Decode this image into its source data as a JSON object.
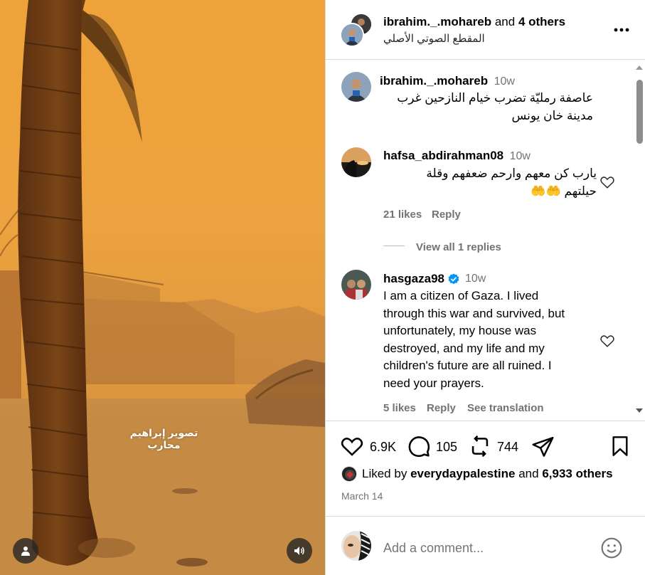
{
  "media": {
    "watermark_text": "تصوير إبراهيم محارب"
  },
  "header": {
    "author": "ibrahim._.mohareb",
    "and_text": "and",
    "others": "4 others",
    "audio_label": "المقطع الصوتي الأصلي"
  },
  "caption": {
    "username": "ibrahim._.mohareb",
    "time": "10w",
    "text_line1": "عاصفة رمليّة تضرب خيام النازحين غرب",
    "text_line2": "مدينة خان يونس"
  },
  "comments": [
    {
      "username": "hafsa_abdirahman08",
      "time": "10w",
      "text_line1": "يارب كن معهم وارحم ضعفهم وقلة",
      "text_line2": "حيلتهم 🤲🤲",
      "likes": "21 likes",
      "reply": "Reply",
      "view_replies": "View all 1 replies"
    },
    {
      "username": "hasgaza98",
      "verified": true,
      "time": "10w",
      "lines": [
        "I am a citizen of Gaza. I lived",
        "through this war and survived, but",
        "unfortunately, my house was",
        "destroyed, and my life and my",
        "children's future are all ruined. I",
        "need your prayers."
      ],
      "likes": "5 likes",
      "reply": "Reply",
      "translation": "See translation"
    }
  ],
  "actions": {
    "likes_count": "6.9K",
    "comments_count": "105",
    "reposts_count": "744"
  },
  "liked_by": {
    "prefix": "Liked by",
    "user": "everydaypalestine",
    "and_text": "and",
    "others": "6,933 others"
  },
  "date": "March 14",
  "add_comment": {
    "placeholder": "Add a comment..."
  },
  "colors": {
    "verified": "#0095f6",
    "muted_text": "#737373",
    "border": "#dbdbdb",
    "sky": "#eea23a"
  }
}
